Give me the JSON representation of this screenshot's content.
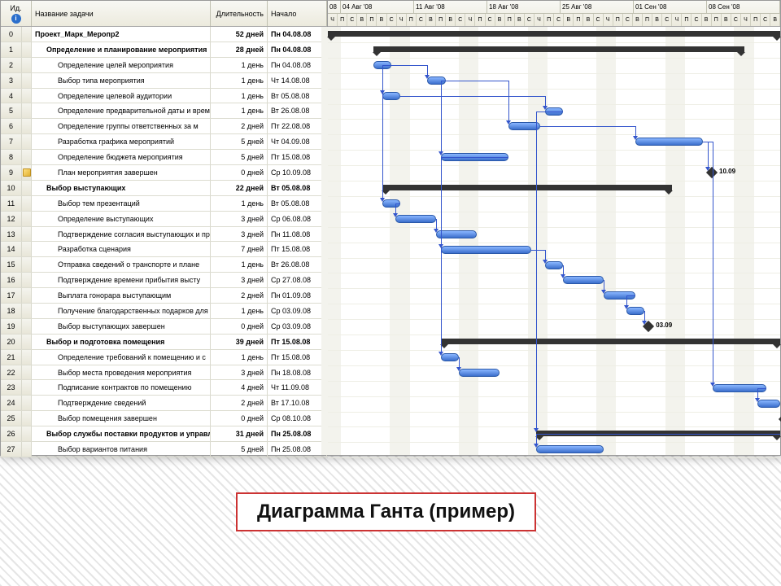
{
  "headers": {
    "id": "Ид.",
    "name": "Название задачи",
    "duration": "Длительность",
    "start": "Начало"
  },
  "timeline_dates": [
    "08",
    "04 Авг '08",
    "11 Авг '08",
    "18 Авг '08",
    "25 Авг '08",
    "01 Сен '08",
    "08 Сен '08"
  ],
  "day_labels": [
    "Ч",
    "П",
    "С",
    "В",
    "П",
    "В",
    "С",
    "Ч",
    "П",
    "С",
    "В",
    "П",
    "В",
    "С",
    "Ч",
    "П",
    "С",
    "В",
    "П",
    "В",
    "С",
    "Ч",
    "П",
    "С",
    "В",
    "П",
    "В",
    "С",
    "Ч",
    "П",
    "С",
    "В",
    "П",
    "В",
    "С",
    "Ч",
    "П",
    "С",
    "В",
    "П",
    "В",
    "С",
    "Ч",
    "П",
    "С",
    "В"
  ],
  "tasks": [
    {
      "id": "0",
      "name": "Проект_Марк_Меропр2",
      "dur": "52 дней",
      "start": "Пн 04.08.08",
      "level": 0,
      "bold": true,
      "type": "summary",
      "bar_start": 0,
      "bar_len": 100
    },
    {
      "id": "1",
      "name": "Определение и планирование мероприятия",
      "dur": "28 дней",
      "start": "Пн 04.08.08",
      "level": 1,
      "bold": true,
      "type": "summary",
      "bar_start": 10,
      "bar_len": 82
    },
    {
      "id": "2",
      "name": "Определение целей мероприятия",
      "dur": "1 день",
      "start": "Пн 04.08.08",
      "level": 2,
      "type": "task",
      "bar_start": 10,
      "bar_len": 4
    },
    {
      "id": "3",
      "name": "Выбор типа мероприятия",
      "dur": "1 день",
      "start": "Чт 14.08.08",
      "level": 2,
      "type": "task",
      "bar_start": 22,
      "bar_len": 4
    },
    {
      "id": "4",
      "name": "Определение целевой аудитории",
      "dur": "1 день",
      "start": "Вт 05.08.08",
      "level": 2,
      "type": "task",
      "bar_start": 12,
      "bar_len": 4
    },
    {
      "id": "5",
      "name": "Определение предварительной даты и времени начала мероприятия",
      "dur": "1 день",
      "start": "Вт 26.08.08",
      "level": 2,
      "type": "task",
      "bar_start": 48,
      "bar_len": 4
    },
    {
      "id": "6",
      "name": "Определение группы ответственных за м",
      "dur": "2 дней",
      "start": "Пт 22.08.08",
      "level": 2,
      "type": "task",
      "bar_start": 40,
      "bar_len": 7
    },
    {
      "id": "7",
      "name": "Разработка графика мероприятий",
      "dur": "5 дней",
      "start": "Чт 04.09.08",
      "level": 2,
      "type": "task",
      "bar_start": 68,
      "bar_len": 15
    },
    {
      "id": "8",
      "name": "Определение бюджета мероприятия",
      "dur": "5 дней",
      "start": "Пт 15.08.08",
      "level": 2,
      "type": "task",
      "bar_start": 25,
      "bar_len": 15
    },
    {
      "id": "9",
      "name": "План мероприятия завершен",
      "dur": "0 дней",
      "start": "Ср 10.09.08",
      "level": 2,
      "type": "milestone",
      "bar_start": 84,
      "note": true,
      "label": "10.09"
    },
    {
      "id": "10",
      "name": "Выбор выступающих",
      "dur": "22 дней",
      "start": "Вт 05.08.08",
      "level": 1,
      "bold": true,
      "type": "summary",
      "bar_start": 12,
      "bar_len": 64
    },
    {
      "id": "11",
      "name": "Выбор тем презентаций",
      "dur": "1 день",
      "start": "Вт 05.08.08",
      "level": 2,
      "type": "task",
      "bar_start": 12,
      "bar_len": 4
    },
    {
      "id": "12",
      "name": "Определение выступающих",
      "dur": "3 дней",
      "start": "Ср 06.08.08",
      "level": 2,
      "type": "task",
      "bar_start": 15,
      "bar_len": 9
    },
    {
      "id": "13",
      "name": "Подтверждение согласия выступающих и прочих сведений",
      "dur": "3 дней",
      "start": "Пн 11.08.08",
      "level": 2,
      "type": "task",
      "bar_start": 24,
      "bar_len": 9
    },
    {
      "id": "14",
      "name": "Разработка сценария",
      "dur": "7 дней",
      "start": "Пт 15.08.08",
      "level": 2,
      "type": "task",
      "bar_start": 25,
      "bar_len": 20
    },
    {
      "id": "15",
      "name": "Отправка сведений о транспорте и плане",
      "dur": "1 день",
      "start": "Вт 26.08.08",
      "level": 2,
      "type": "task",
      "bar_start": 48,
      "bar_len": 4
    },
    {
      "id": "16",
      "name": "Подтверждение времени прибытия высту",
      "dur": "3 дней",
      "start": "Ср 27.08.08",
      "level": 2,
      "type": "task",
      "bar_start": 52,
      "bar_len": 9
    },
    {
      "id": "17",
      "name": "Выплата гонорара выступающим",
      "dur": "2 дней",
      "start": "Пн 01.09.08",
      "level": 2,
      "type": "task",
      "bar_start": 61,
      "bar_len": 7
    },
    {
      "id": "18",
      "name": "Получение благодарственных подарков для выступающих",
      "dur": "1 день",
      "start": "Ср 03.09.08",
      "level": 2,
      "type": "task",
      "bar_start": 66,
      "bar_len": 4
    },
    {
      "id": "19",
      "name": "Выбор выступающих завершен",
      "dur": "0 дней",
      "start": "Ср 03.09.08",
      "level": 2,
      "type": "milestone",
      "bar_start": 70,
      "label": "03.09"
    },
    {
      "id": "20",
      "name": "Выбор и подготовка помещения",
      "dur": "39 дней",
      "start": "Пт 15.08.08",
      "level": 1,
      "bold": true,
      "type": "summary",
      "bar_start": 25,
      "bar_len": 75
    },
    {
      "id": "21",
      "name": "Определение требований к помещению и с",
      "dur": "1 день",
      "start": "Пт 15.08.08",
      "level": 2,
      "type": "task",
      "bar_start": 25,
      "bar_len": 4
    },
    {
      "id": "22",
      "name": "Выбор места проведения мероприятия",
      "dur": "3 дней",
      "start": "Пн 18.08.08",
      "level": 2,
      "type": "task",
      "bar_start": 29,
      "bar_len": 9
    },
    {
      "id": "23",
      "name": "Подписание контрактов по помещению",
      "dur": "4 дней",
      "start": "Чт 11.09.08",
      "level": 2,
      "type": "task",
      "bar_start": 85,
      "bar_len": 12
    },
    {
      "id": "24",
      "name": "Подтверждение сведений",
      "dur": "2 дней",
      "start": "Вт 17.10.08",
      "level": 2,
      "type": "task",
      "bar_start": 95,
      "bar_len": 5
    },
    {
      "id": "25",
      "name": "Выбор помещения завершен",
      "dur": "0 дней",
      "start": "Ср 08.10.08",
      "level": 2,
      "type": "milestone",
      "bar_start": 100
    },
    {
      "id": "26",
      "name": "Выбор службы поставки продуктов и управление поставкой",
      "dur": "31 дней",
      "start": "Пн 25.08.08",
      "level": 1,
      "bold": true,
      "type": "summary",
      "bar_start": 46,
      "bar_len": 54
    },
    {
      "id": "27",
      "name": "Выбор вариантов питания",
      "dur": "5 дней",
      "start": "Пн 25.08.08",
      "level": 2,
      "type": "task",
      "bar_start": 46,
      "bar_len": 15
    }
  ],
  "caption": "Диаграмма Ганта (пример)"
}
